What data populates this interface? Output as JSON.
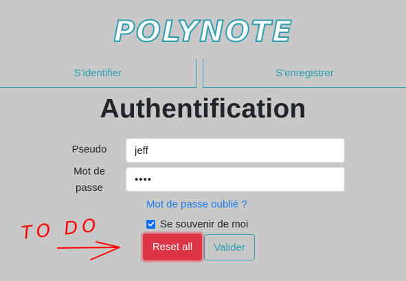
{
  "app": {
    "logo_text": "POLYNOTE"
  },
  "tabs": {
    "login": "S'identifier",
    "register": "S'enregistrer"
  },
  "page": {
    "title": "Authentification"
  },
  "form": {
    "pseudo_label": "Pseudo",
    "pseudo_value": "jeff",
    "password_label_line1": "Mot de",
    "password_label_line2": "passe",
    "password_masked": "••••",
    "forgot_link": "Mot de passe oublié ?",
    "remember_label": "Se souvenir de moi",
    "remember_checked": true,
    "reset_button": "Reset all",
    "submit_button": "Valider"
  },
  "annotation": {
    "text": "TO DO"
  },
  "colors": {
    "background": "#c8c8c8",
    "accent": "#2a9db2",
    "link": "#1f7cef",
    "danger": "#dc3545",
    "annotation": "#ff0000",
    "checkbox": "#0d6efd"
  }
}
